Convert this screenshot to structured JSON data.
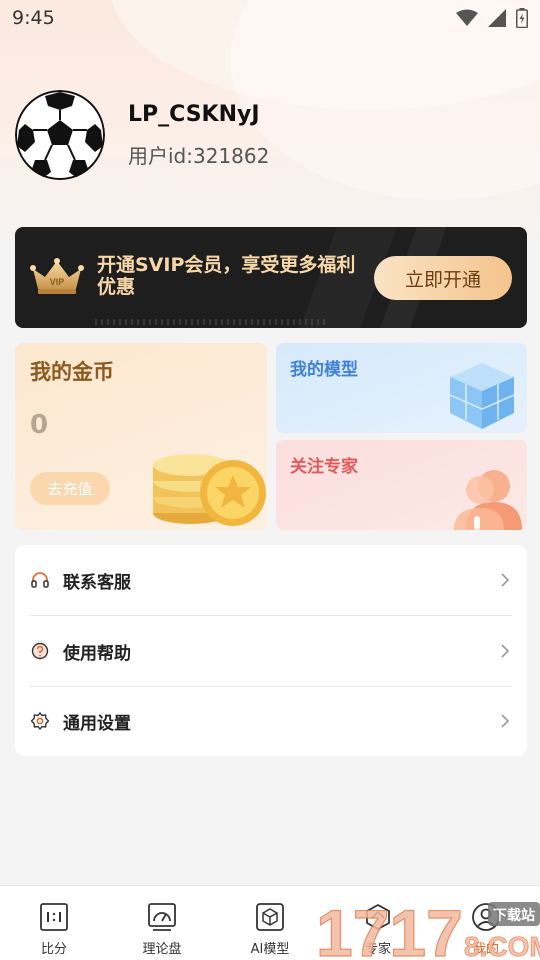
{
  "status_bar": {
    "time": "9:45"
  },
  "profile": {
    "username": "LP_CSKNyJ",
    "user_id": "用户id:321862"
  },
  "vip_banner": {
    "crown_text": "VIP",
    "promo_text": "开通SVIP会员，享受更多福利优惠",
    "button_label": "立即开通"
  },
  "coin_card": {
    "title": "我的金币",
    "balance": "0",
    "recharge_label": "去充值"
  },
  "model_card": {
    "title": "我的模型"
  },
  "expert_card": {
    "title": "关注专家"
  },
  "menu": {
    "items": [
      {
        "label": "联系客服",
        "icon": "headset-icon"
      },
      {
        "label": "使用帮助",
        "icon": "help-icon"
      },
      {
        "label": "通用设置",
        "icon": "settings-gear-icon"
      }
    ]
  },
  "tab_bar": {
    "tabs": [
      {
        "label": "比分",
        "icon": "scoreboard-icon"
      },
      {
        "label": "理论盘",
        "icon": "gauge-icon"
      },
      {
        "label": "AI模型",
        "icon": "cube-icon"
      },
      {
        "label": "专家",
        "icon": "expert-icon"
      },
      {
        "label": "我的",
        "icon": "profile-icon"
      }
    ],
    "active_index": 4
  },
  "watermark": {
    "text": "1717",
    "text2": "8.COM",
    "badge": "下载站"
  },
  "colors": {
    "accent": "#e0601e",
    "vip_gold": "#f7d7a8",
    "coin_brown": "#8b5a1e",
    "model_blue": "#3f82d6",
    "expert_red": "#e15a5a"
  }
}
